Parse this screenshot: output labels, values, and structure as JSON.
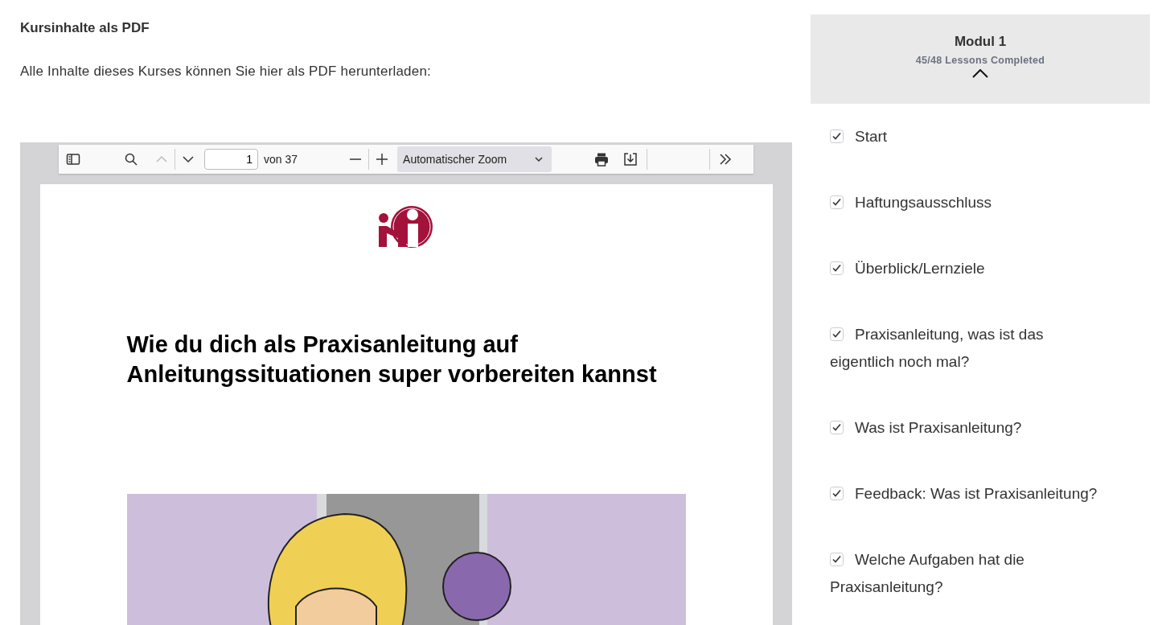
{
  "section": {
    "title": "Kursinhalte als PDF",
    "text": "Alle Inhalte dieses Kurses können Sie hier als PDF herunterladen:"
  },
  "viewer": {
    "toolbar": {
      "page": "1",
      "page_count": "von 37",
      "zoom": "Automatischer Zoom"
    },
    "page": {
      "heading": "Wie du dich als Praxisanleitung auf Anleitungssituationen super vorbereiten kannst"
    }
  },
  "module": {
    "title": "Modul 1",
    "progress": "45/48 Lessons Completed",
    "expanded": true,
    "lessons": [
      {
        "title": "Start",
        "checked": true
      },
      {
        "title": "Haftungsausschluss",
        "checked": true
      },
      {
        "title": "Überblick/Lernziele",
        "checked": true
      },
      {
        "title": "Praxisanleitung, was ist das eigentlich noch mal?",
        "checked": true
      },
      {
        "title": "Was ist Praxisanleitung?",
        "checked": true
      },
      {
        "title": "Feedback: Was ist Praxisanleitung?",
        "checked": true
      },
      {
        "title": "Welche Aufgaben hat die Praxisanleitung?",
        "checked": true
      }
    ]
  }
}
